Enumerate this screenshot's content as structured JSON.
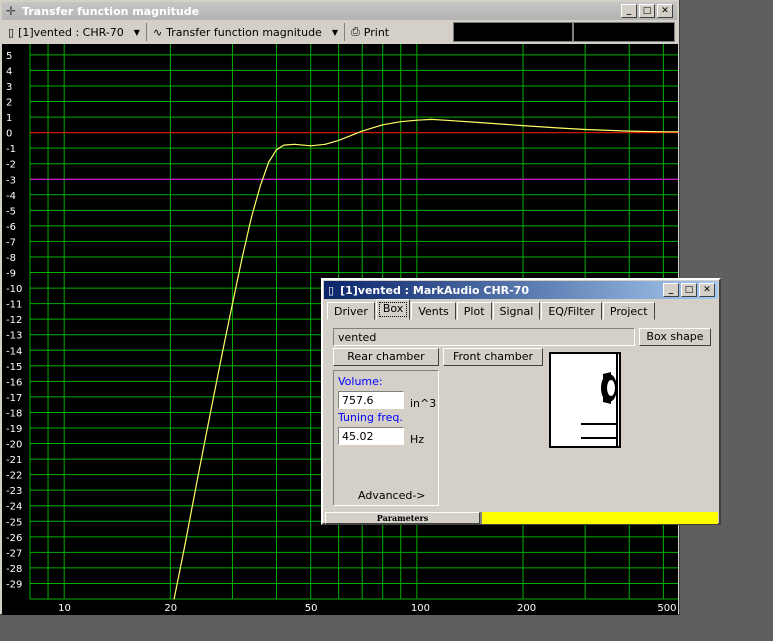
{
  "main_window": {
    "title": "Transfer function magnitude",
    "toolbar": {
      "project_select": "[1]vented : CHR-70",
      "plot_select": "Transfer function magnitude",
      "print_label": "Print"
    }
  },
  "chart_data": {
    "type": "line",
    "x_scale": "log",
    "xlim": [
      8,
      550
    ],
    "ylim": [
      -30,
      5.7
    ],
    "x_tick_labels": [
      "10",
      "20",
      "50",
      "100",
      "200",
      "500"
    ],
    "y_tick_labels": [
      "5",
      "4",
      "3",
      "2",
      "1",
      "0",
      "-1",
      "-2",
      "-3",
      "-4",
      "-5",
      "-6",
      "-7",
      "-8",
      "-9",
      "-10",
      "-11",
      "-12",
      "-13",
      "-14",
      "-15",
      "-16",
      "-17",
      "-18",
      "-19",
      "-20",
      "-21",
      "-22",
      "-23",
      "-24",
      "-25",
      "-26",
      "-27",
      "-28",
      "-29"
    ],
    "grid": true,
    "reference_lines": [
      {
        "y": 0,
        "color": "#ff0000"
      },
      {
        "y": -3,
        "color": "#ff00ff"
      }
    ],
    "series": [
      {
        "color": "#ffff66",
        "x": [
          20.5,
          22,
          24,
          26,
          28,
          30,
          32,
          34,
          36,
          38,
          40,
          42,
          45,
          50,
          55,
          60,
          70,
          80,
          90,
          100,
          110,
          120,
          150,
          200,
          250,
          300,
          400,
          500,
          550
        ],
        "y": [
          -30,
          -26.5,
          -22,
          -18,
          -14.3,
          -11,
          -8,
          -5.4,
          -3.4,
          -1.9,
          -1.1,
          -0.8,
          -0.75,
          -0.85,
          -0.75,
          -0.5,
          0.1,
          0.5,
          0.7,
          0.8,
          0.85,
          0.8,
          0.65,
          0.45,
          0.3,
          0.2,
          0.1,
          0.05,
          0.05
        ]
      }
    ]
  },
  "dialog": {
    "title": "[1]vented : MarkAudio CHR-70",
    "tabs": [
      "Driver",
      "Box",
      "Vents",
      "Plot",
      "Signal",
      "EQ/Filter",
      "Project"
    ],
    "active_tab": "Box",
    "box_type": "vented",
    "box_shape_button": "Box shape",
    "rear_chamber_button": "Rear chamber",
    "front_chamber_button": "Front chamber",
    "volume_label": "Volume:",
    "volume_value": "757.6",
    "volume_unit": "in^3",
    "tuning_label": "Tuning freq.",
    "tuning_value": "45.02",
    "tuning_unit": "Hz",
    "advanced_label": "Advanced->",
    "status_label": "Parameters",
    "status_progress": 1.0
  }
}
